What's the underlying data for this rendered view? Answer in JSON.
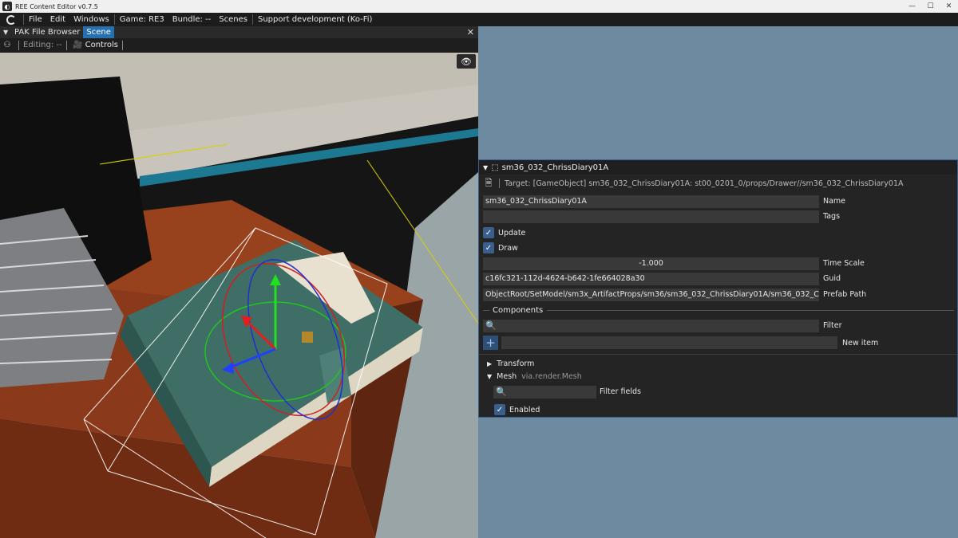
{
  "window": {
    "title": "REE Content Editor v0.7.5",
    "buttons": {
      "minimize": "—",
      "maximize": "☐",
      "close": "✕"
    }
  },
  "menu": {
    "items": [
      "File",
      "Edit",
      "Windows"
    ],
    "game": "Game: RE3",
    "bundle": "Bundle: --",
    "scenes": "Scenes",
    "support": "Support development (Ko-Fi)"
  },
  "scene_panel": {
    "tabs": [
      "PAK File Browser",
      "Scene"
    ],
    "active_tab": "Scene",
    "editing": "Editing: --",
    "controls": "Controls",
    "viewport_icon": "eye-icon"
  },
  "inspector": {
    "object_name": "sm36_032_ChrissDiary01A",
    "target": "Target: [GameObject] sm36_032_ChrissDiary01A: st00_0201_0/props/Drawer//sm36_032_ChrissDiary01A",
    "fields": {
      "name": {
        "value": "sm36_032_ChrissDiary01A",
        "label": "Name"
      },
      "tags": {
        "value": "",
        "label": "Tags"
      },
      "update": {
        "label": "Update",
        "checked": true
      },
      "draw": {
        "label": "Draw",
        "checked": true
      },
      "time_scale": {
        "value": "-1.000",
        "label": "Time Scale"
      },
      "guid": {
        "value": "c16fc321-112d-4624-b642-1fe664028a30",
        "label": "Guid"
      },
      "prefab_path": {
        "value": "ObjectRoot/SetModel/sm3x_ArtifactProps/sm36/sm36_032_ChrissDiary01A/sm36_032_ChrissDi",
        "label": "Prefab Path"
      }
    },
    "components": {
      "title": "Components",
      "filter_label": "Filter",
      "new_item_label": "New item",
      "items": [
        {
          "name": "Transform",
          "expanded": false
        },
        {
          "name": "Mesh",
          "type": "via.render.Mesh",
          "expanded": true
        }
      ],
      "mesh": {
        "filter_fields_label": "Filter fields",
        "enabled_label": "Enabled",
        "enabled": true
      }
    }
  },
  "colors": {
    "accent": "#2670b0",
    "check": "#3a5f8f",
    "background": "#6e8aa0"
  }
}
